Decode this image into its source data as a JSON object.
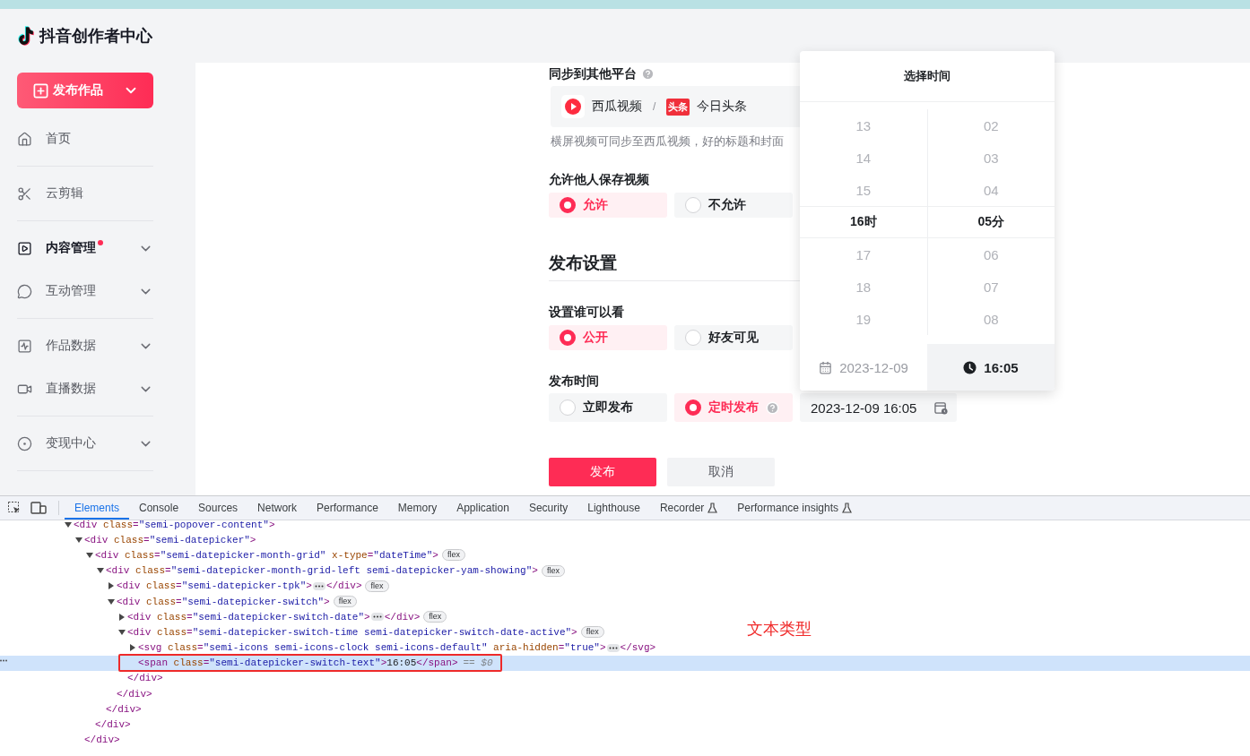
{
  "sidebar": {
    "logo_text": "抖音创作者中心",
    "publish_button": {
      "label": "发布作品"
    },
    "sections": [
      [
        {
          "label": "首页",
          "selected": false,
          "expandable": false,
          "notification": false
        }
      ],
      [
        {
          "label": "云剪辑",
          "selected": false,
          "expandable": false,
          "notification": false
        }
      ],
      [
        {
          "label": "内容管理",
          "selected": true,
          "expandable": true,
          "notification": true
        },
        {
          "label": "互动管理",
          "selected": false,
          "expandable": true,
          "notification": false
        }
      ],
      [
        {
          "label": "作品数据",
          "selected": false,
          "expandable": true,
          "notification": false
        },
        {
          "label": "直播数据",
          "selected": false,
          "expandable": true,
          "notification": false
        }
      ],
      [
        {
          "label": "变现中心",
          "selected": false,
          "expandable": true,
          "notification": false
        }
      ]
    ]
  },
  "form": {
    "sync": {
      "label": "同步到其他平台",
      "help": true,
      "platforms": [
        {
          "name": "西瓜视频",
          "kind": "xigua"
        },
        {
          "name": "今日头条",
          "kind": "toutiao",
          "logo_text": "头条"
        }
      ],
      "separator": "/",
      "hint": "横屏视频可同步至西瓜视频，好的标题和封面"
    },
    "save_permission": {
      "label": "允许他人保存视频",
      "options": [
        {
          "label": "允许",
          "selected": true,
          "help": false
        },
        {
          "label": "不允许",
          "selected": false,
          "help": false
        }
      ]
    },
    "section_title": "发布设置",
    "visibility": {
      "label": "设置谁可以看",
      "options": [
        {
          "label": "公开",
          "selected": true,
          "help": false
        },
        {
          "label": "好友可见",
          "selected": false,
          "help": false
        }
      ]
    },
    "publish_time": {
      "label": "发布时间",
      "options": [
        {
          "label": "立即发布",
          "selected": false,
          "help": false
        },
        {
          "label": "定时发布",
          "selected": true,
          "help": true
        }
      ],
      "datetime_value": "2023-12-09 16:05"
    },
    "buttons": [
      {
        "label": "发布",
        "kind": "primary"
      },
      {
        "label": "取消",
        "kind": "secondary"
      }
    ]
  },
  "time_picker": {
    "title": "选择时间",
    "hours": [
      {
        "label": "13",
        "selected": false
      },
      {
        "label": "14",
        "selected": false
      },
      {
        "label": "15",
        "selected": false
      },
      {
        "label": "16时",
        "selected": true
      },
      {
        "label": "17",
        "selected": false
      },
      {
        "label": "18",
        "selected": false
      },
      {
        "label": "19",
        "selected": false
      }
    ],
    "minutes": [
      {
        "label": "02",
        "selected": false
      },
      {
        "label": "03",
        "selected": false
      },
      {
        "label": "04",
        "selected": false
      },
      {
        "label": "05分",
        "selected": true
      },
      {
        "label": "06",
        "selected": false
      },
      {
        "label": "07",
        "selected": false
      },
      {
        "label": "08",
        "selected": false
      }
    ],
    "switch": [
      {
        "label": "2023-12-09",
        "kind": "date",
        "selected": false
      },
      {
        "label": "16:05",
        "kind": "time",
        "selected": true
      }
    ]
  },
  "devtools": {
    "tabs": [
      {
        "label": "Elements",
        "selected": true,
        "experimental": false
      },
      {
        "label": "Console",
        "selected": false,
        "experimental": false
      },
      {
        "label": "Sources",
        "selected": false,
        "experimental": false
      },
      {
        "label": "Network",
        "selected": false,
        "experimental": false
      },
      {
        "label": "Performance",
        "selected": false,
        "experimental": false
      },
      {
        "label": "Memory",
        "selected": false,
        "experimental": false
      },
      {
        "label": "Application",
        "selected": false,
        "experimental": false
      },
      {
        "label": "Security",
        "selected": false,
        "experimental": false
      },
      {
        "label": "Lighthouse",
        "selected": false,
        "experimental": false
      },
      {
        "label": "Recorder",
        "selected": false,
        "experimental": true
      },
      {
        "label": "Performance insights",
        "selected": false,
        "experimental": true
      }
    ],
    "tree": [
      {
        "open": "<div class=\"semi-popover-content\">",
        "expanded": true,
        "selected": false,
        "children": [
          {
            "open": "<div class=\"semi-datepicker\">",
            "expanded": true,
            "selected": false,
            "close": "</div>",
            "children": [
              {
                "open": "<div class=\"semi-datepicker-month-grid\" x-type=\"dateTime\">",
                "expanded": true,
                "selected": false,
                "badge": "flex",
                "close": "</div>",
                "children": [
                  {
                    "open": "<div class=\"semi-datepicker-month-grid-left semi-datepicker-yam-showing\">",
                    "expanded": true,
                    "selected": false,
                    "badge": "flex",
                    "close": "</div>",
                    "children": [
                      {
                        "open": "<div class=\"semi-datepicker-tpk\">",
                        "expanded": false,
                        "selected": false,
                        "badge": "flex",
                        "close": "</div>"
                      },
                      {
                        "open": "<div class=\"semi-datepicker-switch\">",
                        "expanded": true,
                        "selected": false,
                        "badge": "flex",
                        "close": "</div>",
                        "children": [
                          {
                            "open": "<div class=\"semi-datepicker-switch-date\">",
                            "expanded": false,
                            "selected": false,
                            "badge": "flex",
                            "close": "</div>"
                          },
                          {
                            "open": "<div class=\"semi-datepicker-switch-time semi-datepicker-switch-date-active\">",
                            "expanded": true,
                            "selected": false,
                            "badge": "flex",
                            "close": "</div>",
                            "children": [
                              {
                                "open": "<svg class=\"semi-icons semi-icons-clock semi-icons-default\" aria-hidden=\"true\">",
                                "expanded": false,
                                "selected": false,
                                "close": "</svg>"
                              },
                              {
                                "open": "<span class=\"semi-datepicker-switch-text\">",
                                "content": "16:05",
                                "close": "</span>",
                                "selected": true,
                                "suffix": "== $0"
                              }
                            ]
                          }
                        ]
                      }
                    ]
                  }
                ]
              }
            ]
          }
        ]
      }
    ],
    "annotation": "文本类型"
  }
}
